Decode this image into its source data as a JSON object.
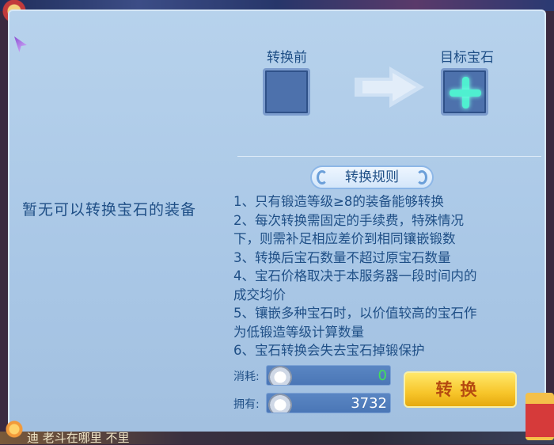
{
  "left": {
    "empty_message": "暂无可以转换宝石的装备"
  },
  "slots": {
    "before_label": "转换前",
    "target_label": "目标宝石"
  },
  "rules": {
    "title": "转换规则",
    "lines": [
      "1、只有锻造等级≥8的装备能够转换",
      "2、每次转换需固定的手续费，特殊情况",
      "下，则需补足相应差价到相同镶嵌锻数",
      "3、转换后宝石数量不超过原宝石数量",
      "4、宝石价格取决于本服务器一段时间内的",
      "成交均价",
      "5、镶嵌多种宝石时，以价值较高的宝石作",
      "为低锻造等级计算数量",
      "6、宝石转换会失去宝石掉锻保护"
    ]
  },
  "cost": {
    "consume_label": "消耗:",
    "consume_value": "0",
    "own_label": "拥有:",
    "own_value": "3732",
    "currency_icon": "silver-ingot-icon"
  },
  "actions": {
    "convert_label": "转换"
  },
  "chat": {
    "text": "迪   老斗在哪里   不里"
  },
  "colors": {
    "text_blue": "#1f4f86",
    "panel_bg": "#b7d2ec",
    "consume_green": "#42e05a",
    "button_gold": "#f7c52a"
  }
}
